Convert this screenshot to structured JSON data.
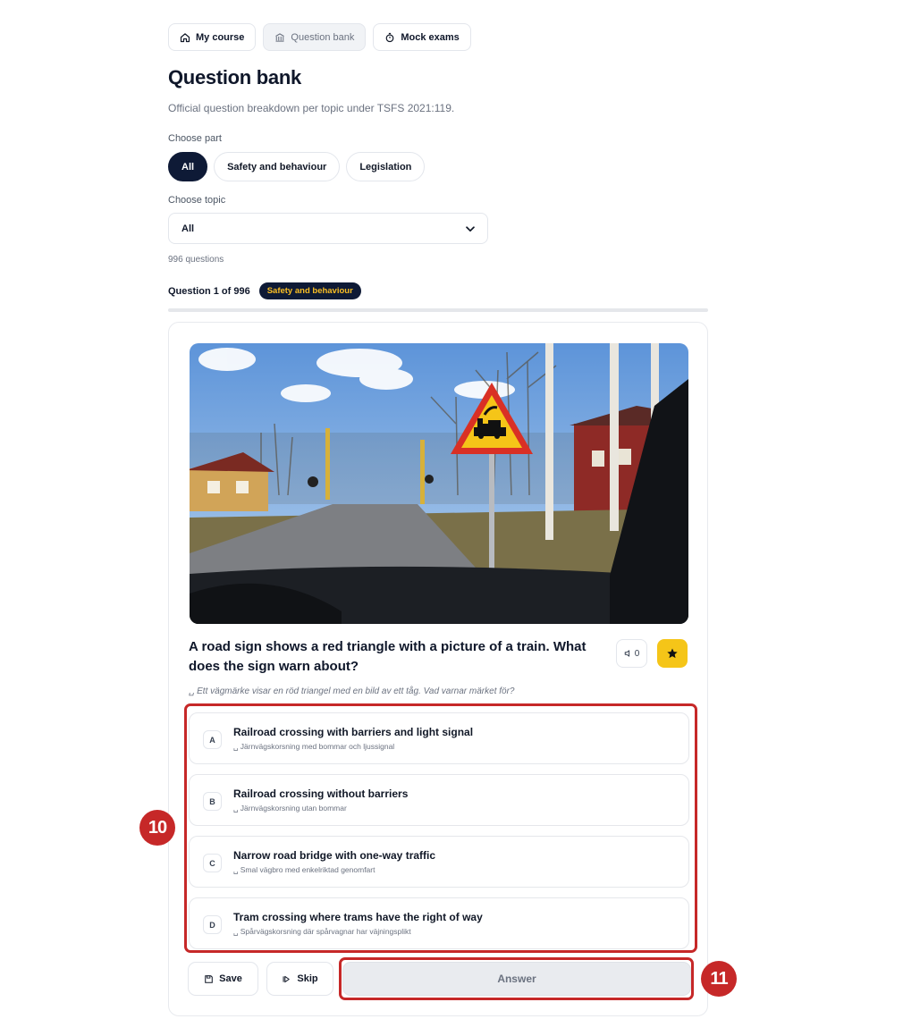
{
  "nav": {
    "my_course": "My course",
    "question_bank": "Question bank",
    "mock_exams": "Mock exams"
  },
  "page": {
    "title": "Question bank",
    "subtitle": "Official question breakdown per topic under TSFS 2021:119."
  },
  "filters": {
    "part_label": "Choose part",
    "parts": [
      "All",
      "Safety and behaviour",
      "Legislation"
    ],
    "selected_part": "All",
    "topic_label": "Choose topic",
    "topic_value": "All",
    "count_text": "996 questions"
  },
  "question": {
    "counter": "Question 1 of 996",
    "category_badge": "Safety and behaviour",
    "progress": 0.001,
    "text": "A road sign shows a red triangle with a picture of a train. What does the sign warn about?",
    "translation": "␣ Ett vägmärke visar en röd triangel med en bild av ett tåg. Vad varnar märket för?",
    "speaker_label": "0",
    "favorited": true
  },
  "options": [
    {
      "letter": "A",
      "text": "Railroad crossing with barriers and light signal",
      "sub": "␣ Järnvägskorsning med bommar och ljussignal"
    },
    {
      "letter": "B",
      "text": "Railroad crossing without barriers",
      "sub": "␣ Järnvägskorsning utan bommar"
    },
    {
      "letter": "C",
      "text": "Narrow road bridge with one-way traffic",
      "sub": "␣ Smal vägbro med enkelriktad genomfart"
    },
    {
      "letter": "D",
      "text": "Tram crossing where trams have the right of way",
      "sub": "␣ Spårvägskorsning där spårvagnar har väjningsplikt"
    }
  ],
  "actions": {
    "save": "Save",
    "skip": "Skip",
    "answer": "Answer"
  },
  "annotations": {
    "marker_options": "10",
    "marker_answer": "11",
    "color": "#c62828"
  },
  "icons": {
    "my_course": "home-icon",
    "question_bank": "bank-icon",
    "mock_exams": "stopwatch-icon",
    "speaker": "speaker-icon",
    "star": "star-icon",
    "save": "floppy-icon",
    "skip": "skip-icon",
    "select": "chevron-down-icon"
  },
  "colors": {
    "navy": "#0e1a36",
    "badge_text": "#fbbf24",
    "star_bg": "#f5c518"
  }
}
